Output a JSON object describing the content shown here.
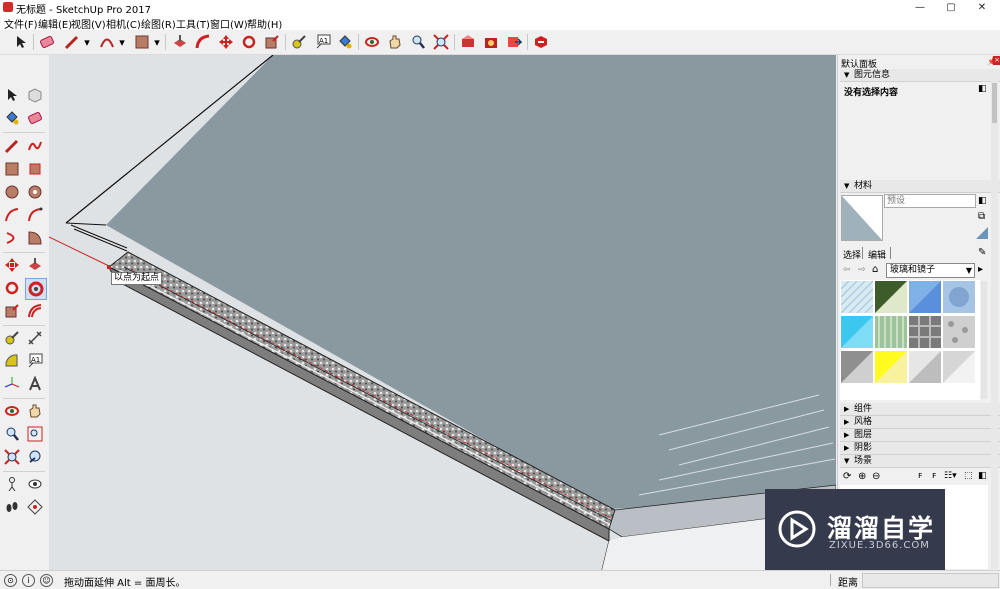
{
  "window": {
    "title": "无标题 - SketchUp Pro 2017"
  },
  "menu": [
    "文件(F)",
    "编辑(E)",
    "视图(V)",
    "相机(C)",
    "绘图(R)",
    "工具(T)",
    "窗口(W)",
    "帮助(H)"
  ],
  "toolbar_icons": [
    "select-icon",
    "eraser-icon",
    "pencil-icon",
    "arc-icon",
    "rectangle-icon",
    "push-pull-icon",
    "follow-me-icon",
    "move-icon",
    "rotate-icon",
    "scale-icon",
    "tape-measure-icon",
    "text-icon",
    "paint-bucket-icon",
    "orbit-icon",
    "pan-icon",
    "zoom-icon",
    "zoom-extents-icon",
    "3d-warehouse-icon",
    "extension-warehouse-icon",
    "send-to-layout-icon",
    "extension-manager-icon"
  ],
  "left_toolbar_icons": [
    "select-icon",
    "make-component-icon",
    "paint-bucket-icon",
    "eraser-icon",
    "line-icon",
    "freehand-icon",
    "rectangle-icon",
    "rotated-rectangle-icon",
    "circle-icon",
    "polygon-icon",
    "arc-icon",
    "two-point-arc-icon",
    "three-point-arc-icon",
    "pie-icon",
    "move-icon",
    "push-pull-icon",
    "rotate-icon",
    "follow-me-icon",
    "scale-icon",
    "offset-icon",
    "tape-measure-icon",
    "dimension-icon",
    "protractor-icon",
    "text-icon",
    "axes-icon",
    "3d-text-icon",
    "orbit-icon",
    "pan-icon",
    "zoom-icon",
    "zoom-window-icon",
    "zoom-extents-icon",
    "previous-view-icon",
    "position-camera-icon",
    "look-around-icon",
    "walk-icon",
    "section-plane-icon"
  ],
  "viewport": {
    "tooltip": "以点为起点"
  },
  "tray": {
    "title": "默认面板",
    "entity_info": {
      "header": "图元信息",
      "status": "没有选择内容"
    },
    "materials": {
      "header": "材料",
      "name_placeholder": "预设",
      "tab_select": "选择",
      "tab_edit": "编辑",
      "library": "玻璃和镜子"
    },
    "swatch_colors": [
      "#d9eaf2",
      "#3e5b2b",
      "#7fb0e8",
      "#a6c4e6",
      "#3cc7ee",
      "#9ec39b",
      "#7a7a7a",
      "#cfcfcf",
      "#8f8f8f",
      "#fffb1e",
      "#bdbdbd",
      "#d6d6d6"
    ],
    "panels": [
      "组件",
      "风格",
      "图层",
      "阴影",
      "场景"
    ]
  },
  "status": {
    "hint": "拖动面延伸  Alt = 面周长。",
    "measure_label": "距离"
  },
  "watermark": {
    "brand": "溜溜自学",
    "url": "ZIXUE.3D66.COM"
  }
}
